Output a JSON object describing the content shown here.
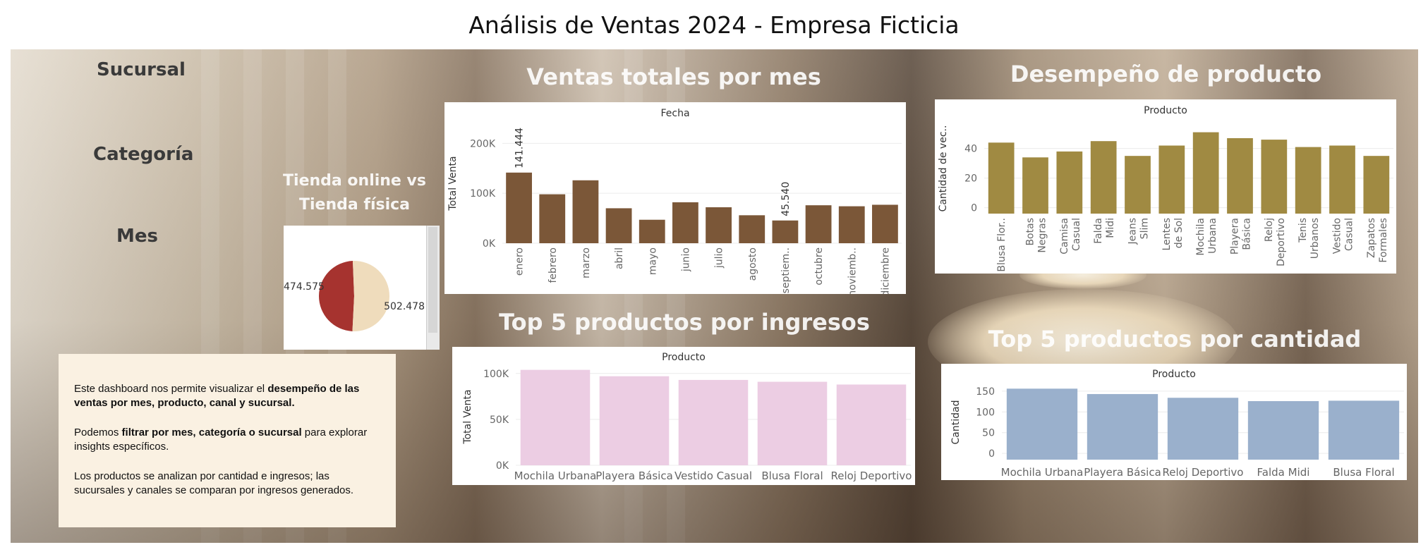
{
  "page": {
    "title": "Análisis de Ventas 2024 - Empresa Ficticia"
  },
  "filters": {
    "sucursal": "Sucursal",
    "categoria": "Categoría",
    "mes": "Mes"
  },
  "headings": {
    "canal": "Tienda online vs\nTienda física",
    "ventas_mes": "Ventas totales por mes",
    "desempeno": "Desempeño de producto",
    "top_ingresos": "Top 5 productos por ingresos",
    "top_cantidad": "Top 5 productos por cantidad"
  },
  "description": {
    "p1_pre": "Este dashboard nos permite visualizar el ",
    "p1_bold": "desempeño de las ventas por mes, producto, canal y sucursal.",
    "p2_pre": "Podemos ",
    "p2_bold": "filtrar por mes, categoría o sucursal",
    "p2_post": " para explorar insights específicos.",
    "p3": "Los productos se analizan por cantidad e ingresos; las sucursales y canales se comparan por ingresos generados."
  },
  "colors": {
    "monthly": "#7b5738",
    "product": "#a08a42",
    "revenue": "#eccde3",
    "quantity": "#9ab0cc",
    "pie_online": "#a6332f",
    "pie_fisica": "#efdcbc"
  },
  "chart_data": [
    {
      "id": "ventas_mes",
      "type": "bar",
      "title": "",
      "header": "Fecha",
      "ylabel": "Total Venta",
      "categories": [
        "enero",
        "febrero",
        "marzo",
        "abril",
        "mayo",
        "junio",
        "julio",
        "agosto",
        "septiem..",
        "octubre",
        "noviemb..",
        "diciembre"
      ],
      "values": [
        141444,
        98000,
        126000,
        70000,
        47000,
        82000,
        72000,
        56000,
        45540,
        76000,
        74000,
        77000
      ],
      "ylim": [
        0,
        240000
      ],
      "yticks": [
        0,
        100000,
        200000
      ],
      "ytick_labels": [
        "0K",
        "100K",
        "200K"
      ],
      "data_labels": [
        {
          "index": 0,
          "text": "141.444"
        },
        {
          "index": 8,
          "text": "45.540"
        }
      ],
      "grid": true
    },
    {
      "id": "desempeno",
      "type": "bar",
      "title": "",
      "header": "Producto",
      "ylabel": "Cantidad de vec..",
      "categories": [
        "Blusa Flor..",
        "Botas Negras",
        "Camisa Casual",
        "Falda Midi",
        "Jeans Slim",
        "Lentes de Sol",
        "Mochila Urbana",
        "Playera Básica",
        "Reloj Deportivo",
        "Tenis Urbanos",
        "Vestido Casual",
        "Zapatos Formales"
      ],
      "values": [
        44,
        34,
        38,
        45,
        35,
        42,
        51,
        47,
        46,
        41,
        42,
        35
      ],
      "ylim": [
        -4,
        57
      ],
      "yticks": [
        0,
        20,
        40
      ],
      "ytick_labels": [
        "0",
        "20",
        "40"
      ],
      "grid": true
    },
    {
      "id": "top_ingresos",
      "type": "bar",
      "title": "",
      "header": "Producto",
      "ylabel": "Total Venta",
      "categories": [
        "Mochila Urbana",
        "Playera Básica",
        "Vestido Casual",
        "Blusa Floral",
        "Reloj Deportivo"
      ],
      "values": [
        104000,
        97000,
        93000,
        91000,
        88000
      ],
      "ylim": [
        0,
        106000
      ],
      "yticks": [
        0,
        50000,
        100000
      ],
      "ytick_labels": [
        "0K",
        "50K",
        "100K"
      ],
      "grid": true
    },
    {
      "id": "top_cantidad",
      "type": "bar",
      "title": "",
      "header": "Producto",
      "ylabel": "Cantidad",
      "categories": [
        "Mochila Urbana",
        "Playera Básica",
        "Reloj Deportivo",
        "Falda Midi",
        "Blusa Floral"
      ],
      "values": [
        156,
        143,
        134,
        126,
        127
      ],
      "ylim": [
        -15,
        165
      ],
      "yticks": [
        0,
        50,
        100,
        150
      ],
      "ytick_labels": [
        "0",
        "50",
        "100",
        "150"
      ],
      "grid": true
    },
    {
      "id": "canal",
      "type": "pie",
      "title": "",
      "slices": [
        {
          "label": "474.575",
          "value": 474575
        },
        {
          "label": "502.478",
          "value": 502478
        }
      ]
    }
  ]
}
